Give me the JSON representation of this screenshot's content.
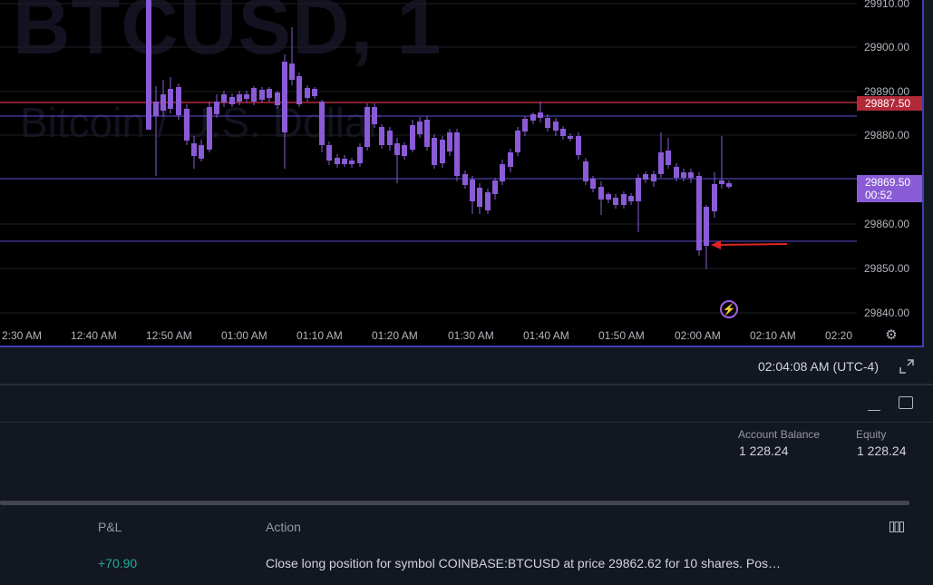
{
  "chart": {
    "symbol": "BTCUSD, 1",
    "description": "Bitcoin / U.S. Dollar",
    "price_labels": [
      "29910.00",
      "29900.00",
      "29890.00",
      "29880.00",
      "29860.00",
      "29850.00",
      "29840.00"
    ],
    "time_labels": [
      "2:30 AM",
      "12:40 AM",
      "12:50 AM",
      "01:00 AM",
      "01:10 AM",
      "01:20 AM",
      "01:30 AM",
      "01:40 AM",
      "01:50 AM",
      "02:00 AM",
      "02:10 AM",
      "02:20"
    ],
    "hline_price": "29887.50",
    "last_price": "29869.50",
    "countdown": "00:52",
    "colors": {
      "candle": "#8a5bd6",
      "hline_red": "#b2293a",
      "hline_purple": "#5d4fd6",
      "arrow": "#e02424"
    },
    "icons": [
      "lightning-icon",
      "gear-icon"
    ]
  },
  "status": {
    "clock": "02:04:08 AM (UTC-4)"
  },
  "account": {
    "balance_label": "Account Balance",
    "balance_value": "1 228.24",
    "equity_label": "Equity",
    "equity_value": "1 228.24"
  },
  "table": {
    "headers": {
      "pnl": "P&L",
      "action": "Action"
    },
    "rows": [
      {
        "pnl": "+70.90",
        "action": "Close long position for symbol COINBASE:BTCUSD at price 29862.62 for 10 shares. Pos…"
      }
    ]
  }
}
